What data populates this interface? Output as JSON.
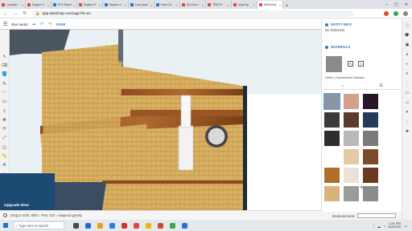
{
  "browser": {
    "tabs": [
      {
        "label": "Location",
        "color": "#e94335",
        "active": false
      },
      {
        "label": "Engine H",
        "color": "#e94335",
        "active": false
      },
      {
        "label": "RLT Racin",
        "color": "#1a73e8",
        "active": false
      },
      {
        "label": "Engine Fr",
        "color": "#e94335",
        "active": false
      },
      {
        "label": "Subaru e",
        "color": "#1a73e8",
        "active": false
      },
      {
        "label": "Low pane",
        "color": "#1a73e8",
        "active": false
      },
      {
        "label": "How Ca",
        "color": "#1a73e8",
        "active": false
      },
      {
        "label": "(2) How t",
        "color": "#e94335",
        "active": false
      },
      {
        "label": "TRUTH",
        "color": "#e94335",
        "active": false
      },
      {
        "label": "Insta Sp",
        "color": "#e94335",
        "active": false
      },
      {
        "label": "SketchUp",
        "color": "#e84c3d",
        "active": true
      }
    ],
    "new_tab_label": "+",
    "url": "app.sketchup.com/app?hl=en"
  },
  "sketchup": {
    "model_name": "Bus seats",
    "save_label": "SAVE"
  },
  "left_tools": [
    "select-tool",
    "eraser-tool",
    "paint-tool",
    "line-tool",
    "arc-tool",
    "shape-tool",
    "pushpull-tool",
    "move-tool",
    "rotate-tool",
    "scale-tool",
    "offset-tool",
    "tape-tool",
    "text-tool",
    "orbit-tool",
    "pan-tool",
    "zoom-tool"
  ],
  "upgrade_label": "Upgrade Now",
  "status_text": "Drag to orbit. Shift = Pan, Ctrl = suspend gravity",
  "panel": {
    "entity_info_title": "ENTITY INFO",
    "no_selection": "No Selection",
    "materials_title": "MATERIALS",
    "material_name": "Helen_Translucent Glasses",
    "swatches": [
      "#8a96a1",
      "#d4a08a",
      "#2a1526",
      "#3a3a3a",
      "#5a3d2e",
      "#243a58",
      "#2d2d2d",
      "#b9b9b9",
      "#7a7a7a",
      "#ffffff",
      "#e3c9a4",
      "#7b4a2a",
      "#b16e2a",
      "#e9e2d6",
      "#6a3a1e",
      "#d8b47a",
      "#9b9b9b",
      "#8b8b8b"
    ]
  },
  "measurements_label": "Measurements",
  "taskbar": {
    "search_placeholder": "Type here to search",
    "apps": [
      "#4a4a4a",
      "#1d6fd1",
      "#e3a21a",
      "#2c7be5",
      "#d93025",
      "#e94335",
      "#f4b400",
      "#d14836",
      "#3ba84b",
      "#2a73c7"
    ],
    "time": "1:31 PM",
    "date": "8/4/2020"
  }
}
